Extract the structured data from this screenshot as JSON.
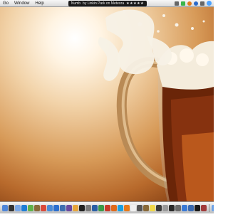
{
  "menubar": {
    "items": [
      "Go",
      "Window",
      "Help"
    ],
    "now_playing": {
      "title": "Numb",
      "artist_line": "by Linkin Park on Meteora",
      "rating": "★★★★★"
    }
  },
  "wallpaper": {
    "description": "beer mug splash",
    "colors": {
      "background_light": "#fff4e3",
      "background_dark": "#8a4416",
      "beer": "#7a2b10",
      "foam": "#f5efe2"
    }
  },
  "dock": {
    "apps": [
      "finder-icon",
      "dashboard-icon",
      "mail-icon",
      "safari-icon",
      "ichat-icon",
      "address-book-icon",
      "ical-icon",
      "preview-icon",
      "itunes-icon",
      "iphoto-icon",
      "imovie-icon",
      "garageband-icon",
      "terminal-icon",
      "system-preferences-icon",
      "photoshop-icon",
      "dreamweaver-icon",
      "flash-icon",
      "firefox-icon",
      "skype-icon",
      "vlc-icon",
      "textedit-icon",
      "calculator-icon",
      "chess-icon",
      "stickies-icon",
      "activity-monitor-icon",
      "disk-utility-icon",
      "console-icon",
      "font-book-icon",
      "app-store-icon",
      "quicktime-icon",
      "dvd-player-icon",
      "photo-booth-icon"
    ],
    "colors": [
      "#4f86d8",
      "#333333",
      "#7aa8e8",
      "#1f7ed6",
      "#5fb24a",
      "#8a6a3a",
      "#d94a3a",
      "#4a8bd6",
      "#2b6fcf",
      "#3f6fb0",
      "#6a4aa0",
      "#e8a53a",
      "#222222",
      "#7a7a7a",
      "#2a5fa5",
      "#3a9a4a",
      "#c83a2a",
      "#e06a1a",
      "#1aa0e0",
      "#e87a1a",
      "#f0f0f0",
      "#555555",
      "#8a6a3a",
      "#f0d84a",
      "#3a3a3a",
      "#9a9a9a",
      "#2a2a2a",
      "#6a6a6a",
      "#3a7ad6",
      "#3a6ab0",
      "#1a1a1a",
      "#a03a3a"
    ],
    "right_items": [
      "documents-folder-icon",
      "downloads-folder-icon",
      "trash-icon"
    ]
  }
}
